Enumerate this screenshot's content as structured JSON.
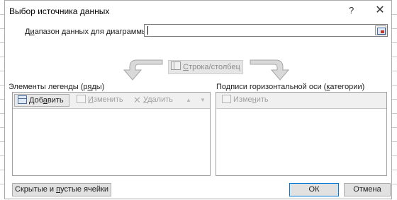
{
  "dialog": {
    "title": "Выбор источника данных",
    "help_label": "?",
    "close_label": "✕"
  },
  "range": {
    "label_pre": "Д",
    "label_u": "и",
    "label_post": "апазон данных для диаграммы:",
    "value": ""
  },
  "swap": {
    "label_u": "С",
    "label_post": "трока/столбец"
  },
  "legend": {
    "title_pre": "Элементы легенды (р",
    "title_u": "я",
    "title_post": "ды)",
    "add_pre": "Доб",
    "add_u": "а",
    "add_post": "вить",
    "edit_u": "И",
    "edit_post": "зменить",
    "delete_u": "У",
    "delete_post": "далить",
    "up_icon": "arrow-up-icon",
    "down_icon": "arrow-down-icon"
  },
  "category": {
    "title_pre": "Подписи горизонтальной оси (",
    "title_u": "к",
    "title_post": "атегории)",
    "edit_pre": "Изме",
    "edit_u": "н",
    "edit_post": "ить"
  },
  "footer": {
    "hidden_pre": "Скрытые и ",
    "hidden_u": "п",
    "hidden_post": "устые ячейки",
    "ok_label": "ОК",
    "cancel_label": "Отмена"
  },
  "colors": {
    "accent": "#0078d7",
    "disabled_text": "#a0a0a0",
    "arrow_gray": "#b3b3b3"
  }
}
